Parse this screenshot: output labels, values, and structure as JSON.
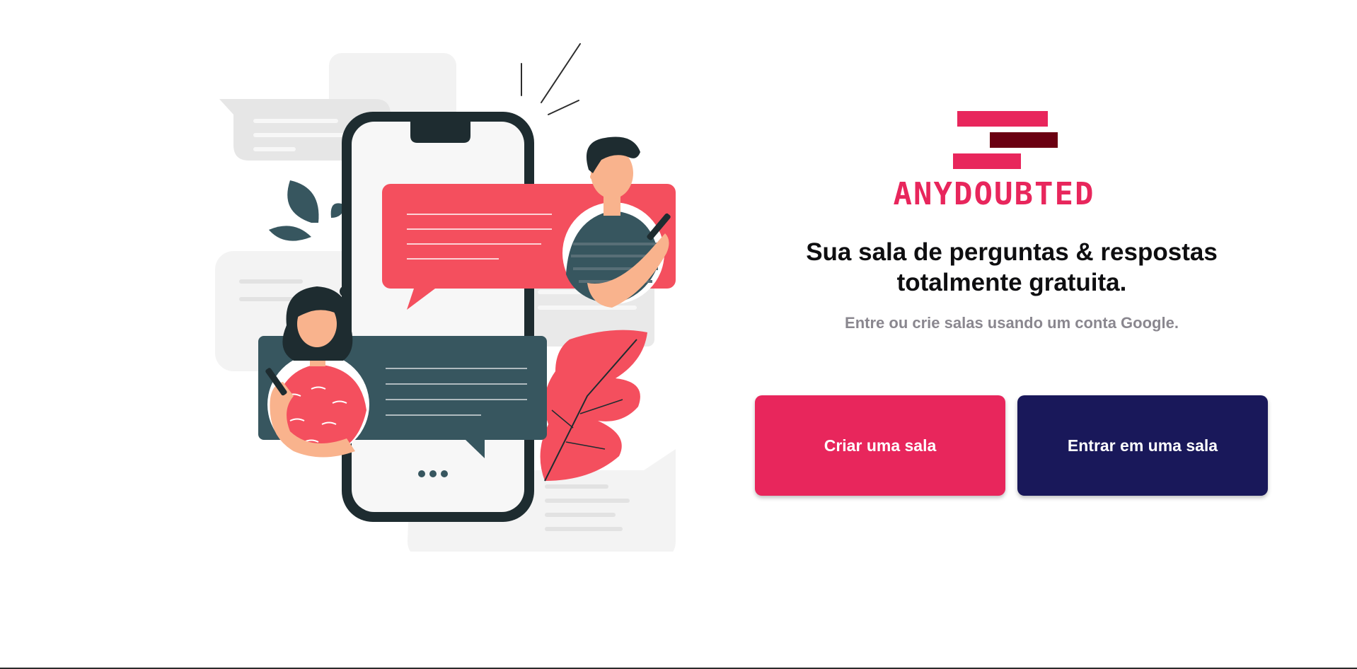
{
  "brand": {
    "name": "ANYDOUBTED",
    "colors": {
      "primary": "#e8265c",
      "dark": "#6b0011",
      "navy": "#19185a"
    }
  },
  "hero": {
    "headline_line1": "Sua sala de perguntas & respostas",
    "headline_line2": "totalmente gratuita.",
    "subtitle": "Entre ou crie salas usando um conta Google."
  },
  "actions": {
    "create_label": "Criar uma sala",
    "join_label": "Entrar em uma sala"
  },
  "illustration": {
    "icon": "chat-illustration",
    "colors": {
      "coral": "#f44f5e",
      "slate": "#37565f",
      "phone": "#1e2c30",
      "skin": "#f9b38d"
    }
  }
}
